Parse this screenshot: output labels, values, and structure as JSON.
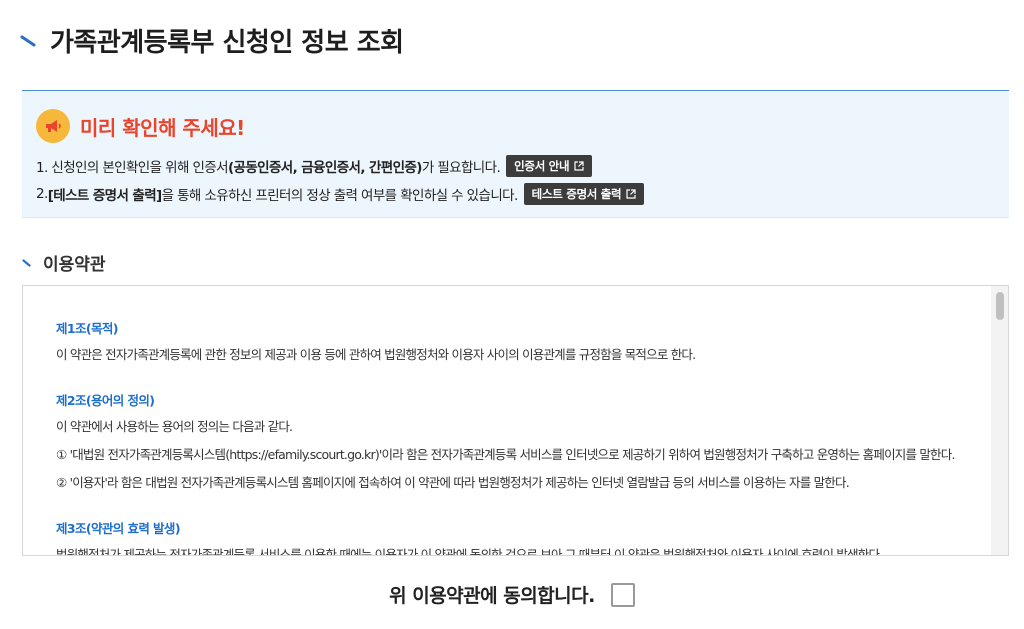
{
  "page": {
    "title": "가족관계등록부 신청인 정보 조회"
  },
  "notice": {
    "title": "미리 확인해 주세요!",
    "line1": {
      "prefix": "1. 신청인의 본인확인을 위해 인증서",
      "bold": "(공동인증서, 금융인증서, 간편인증)",
      "suffix": "가 필요합니다.",
      "button": "인증서 안내"
    },
    "line2": {
      "prefix": "2. ",
      "bold": "[테스트 증명서 출력]",
      "suffix": "을 통해 소유하신 프린터의 정상 출력 여부를 확인하실 수 있습니다.",
      "button": "테스트 증명서 출력"
    }
  },
  "terms": {
    "section_title": "이용약관",
    "articles": [
      {
        "title": "제1조(목적)",
        "lines": [
          "이 약관은 전자가족관계등록에 관한 정보의 제공과 이용 등에 관하여 법원행정처와 이용자 사이의 이용관계를 규정함을 목적으로 한다."
        ]
      },
      {
        "title": "제2조(용어의 정의)",
        "lines": [
          "이 약관에서 사용하는 용어의 정의는 다음과 같다.",
          "① '대법원 전자가족관계등록시스템(https://efamily.scourt.go.kr)'이라 함은 전자가족관계등록 서비스를 인터넷으로 제공하기 위하여 법원행정처가 구축하고 운영하는 홈페이지를 말한다.",
          "② '이용자'라 함은 대법원 전자가족관계등록시스템 홈페이지에 접속하여 이 약관에 따라 법원행정처가 제공하는 인터넷 열람발급 등의 서비스를 이용하는 자를 말한다."
        ]
      },
      {
        "title": "제3조(약관의 효력 발생)",
        "lines": [
          "법원행정처가 제공하는 전자가족관계등록 서비스를 이용한 때에는 이용자가 이 약관에 동의한 것으로 보아 그 때부터 이 약관은 법원행정처와 이용자 사이에 효력이 발생한다."
        ]
      }
    ],
    "agree_label": "위 이용약관에 동의합니다."
  },
  "colors": {
    "accent_blue": "#1f6fd1",
    "notice_red": "#e8452c",
    "notice_bg": "#eef6fd",
    "button_dark": "#3c3c3c"
  },
  "icons": {
    "title_mark": "slash-accent-icon",
    "notice": "megaphone-icon",
    "button_ext": "external-link-icon",
    "checkbox": "checkbox-unchecked"
  }
}
